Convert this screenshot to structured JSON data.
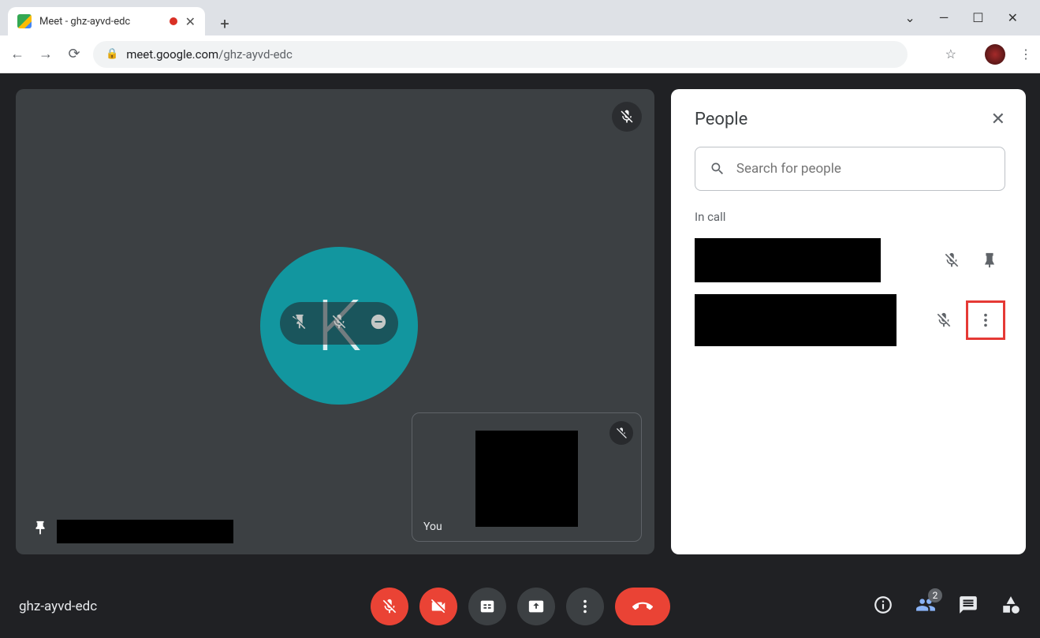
{
  "browser": {
    "tab_title": "Meet - ghz-ayvd-edc",
    "url_host": "meet.google.com",
    "url_path": "/ghz-ayvd-edc"
  },
  "meet": {
    "meeting_code": "ghz-ayvd-edc",
    "main_avatar_letter": "K",
    "self_label": "You",
    "people_count_badge": "2"
  },
  "panel": {
    "title": "People",
    "search_placeholder": "Search for people",
    "section_label": "In call"
  }
}
